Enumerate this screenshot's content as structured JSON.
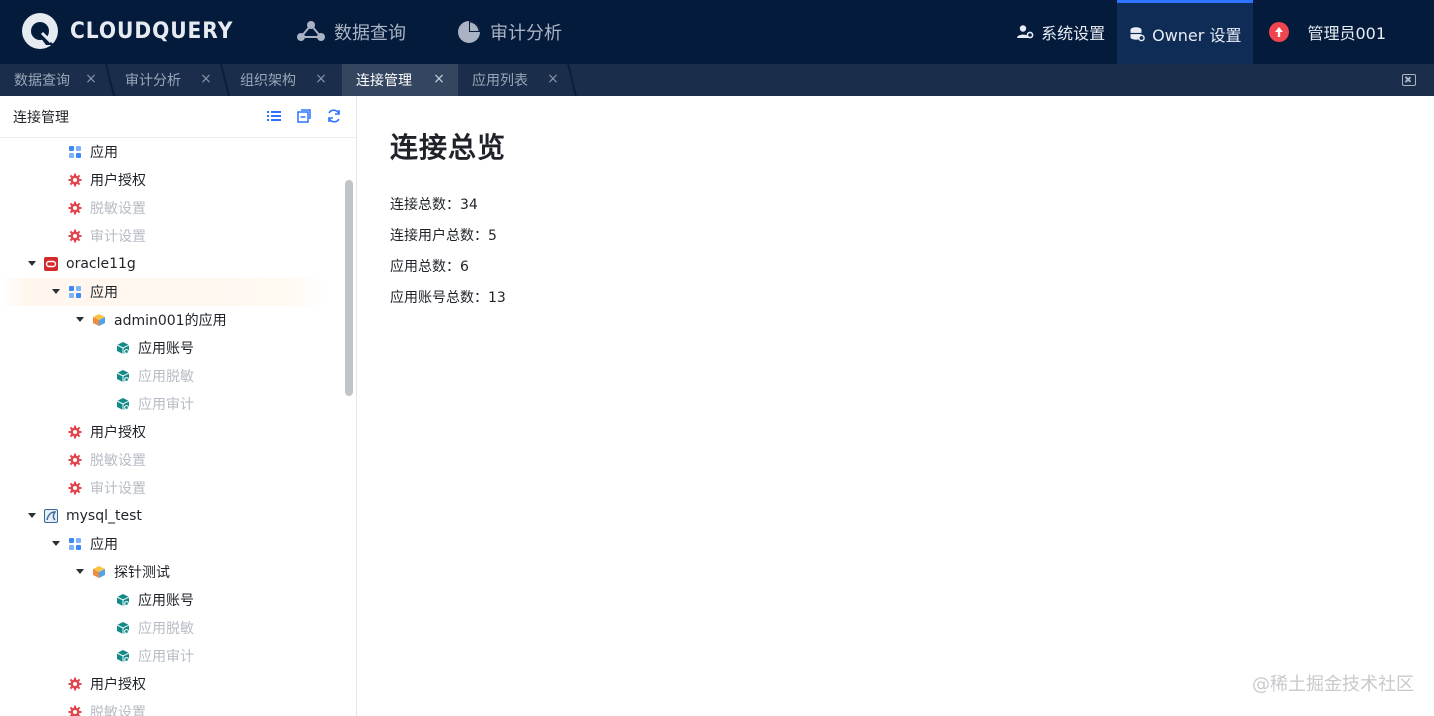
{
  "app": {
    "logo_text": "CLOUDQUERY"
  },
  "topnav": [
    {
      "label": "数据查询",
      "icon": "share-nodes-icon"
    },
    {
      "label": "审计分析",
      "icon": "pie-chart-icon"
    }
  ],
  "topright": {
    "system_settings": "系统设置",
    "owner_settings": "Owner 设置",
    "upgrade_icon": "upload-arrow-icon",
    "user": "管理员001"
  },
  "tabs": [
    {
      "label": "数据查询",
      "active": false
    },
    {
      "label": "审计分析",
      "active": false
    },
    {
      "label": "组织架构",
      "active": false
    },
    {
      "label": "连接管理",
      "active": true
    },
    {
      "label": "应用列表",
      "active": false
    }
  ],
  "tab_close_glyph": "×",
  "sidebar": {
    "title": "连接管理",
    "tools": [
      "list-icon",
      "collapse-icon",
      "refresh-icon"
    ],
    "tree": [
      {
        "label": "应用",
        "icon": "app-grid-icon",
        "level": 2,
        "caret": false,
        "disabled": false
      },
      {
        "label": "用户授权",
        "icon": "gear-icon",
        "level": 2,
        "caret": false,
        "disabled": false
      },
      {
        "label": "脱敏设置",
        "icon": "gear-icon",
        "level": 2,
        "caret": false,
        "disabled": true
      },
      {
        "label": "审计设置",
        "icon": "gear-icon",
        "level": 2,
        "caret": false,
        "disabled": true
      },
      {
        "label": "oracle11g",
        "icon": "oracle-icon",
        "level": 1,
        "caret": true,
        "disabled": false
      },
      {
        "label": "应用",
        "icon": "app-grid-icon",
        "level": 2,
        "caret": true,
        "disabled": false,
        "highlight": true
      },
      {
        "label": "admin001的应用",
        "icon": "cube-icon",
        "level": 3,
        "caret": true,
        "disabled": false
      },
      {
        "label": "应用账号",
        "icon": "package-icon",
        "level": 4,
        "caret": false,
        "disabled": false
      },
      {
        "label": "应用脱敏",
        "icon": "package-icon",
        "level": 4,
        "caret": false,
        "disabled": true
      },
      {
        "label": "应用审计",
        "icon": "package-icon",
        "level": 4,
        "caret": false,
        "disabled": true
      },
      {
        "label": "用户授权",
        "icon": "gear-icon",
        "level": 2,
        "caret": false,
        "disabled": false
      },
      {
        "label": "脱敏设置",
        "icon": "gear-icon",
        "level": 2,
        "caret": false,
        "disabled": true
      },
      {
        "label": "审计设置",
        "icon": "gear-icon",
        "level": 2,
        "caret": false,
        "disabled": true
      },
      {
        "label": "mysql_test",
        "icon": "mysql-icon",
        "level": 1,
        "caret": true,
        "disabled": false
      },
      {
        "label": "应用",
        "icon": "app-grid-icon",
        "level": 2,
        "caret": true,
        "disabled": false
      },
      {
        "label": "探针测试",
        "icon": "cube-icon",
        "level": 3,
        "caret": true,
        "disabled": false
      },
      {
        "label": "应用账号",
        "icon": "package-icon",
        "level": 4,
        "caret": false,
        "disabled": false
      },
      {
        "label": "应用脱敏",
        "icon": "package-icon",
        "level": 4,
        "caret": false,
        "disabled": true
      },
      {
        "label": "应用审计",
        "icon": "package-icon",
        "level": 4,
        "caret": false,
        "disabled": true
      },
      {
        "label": "用户授权",
        "icon": "gear-icon",
        "level": 2,
        "caret": false,
        "disabled": false
      },
      {
        "label": "脱敏设置",
        "icon": "gear-icon",
        "level": 2,
        "caret": false,
        "disabled": true
      }
    ]
  },
  "main": {
    "title": "连接总览",
    "stats": [
      "连接总数：34",
      "连接用户总数：5",
      "应用总数：6",
      "应用账号总数：13"
    ]
  },
  "watermark": "@稀土掘金技术社区",
  "colors": {
    "header_bg": "#041b3c",
    "tabbar_bg": "#1a2d4a",
    "active_tab_bg": "#33455f",
    "accent": "#2f74ff",
    "upgrade": "#f0454e"
  }
}
